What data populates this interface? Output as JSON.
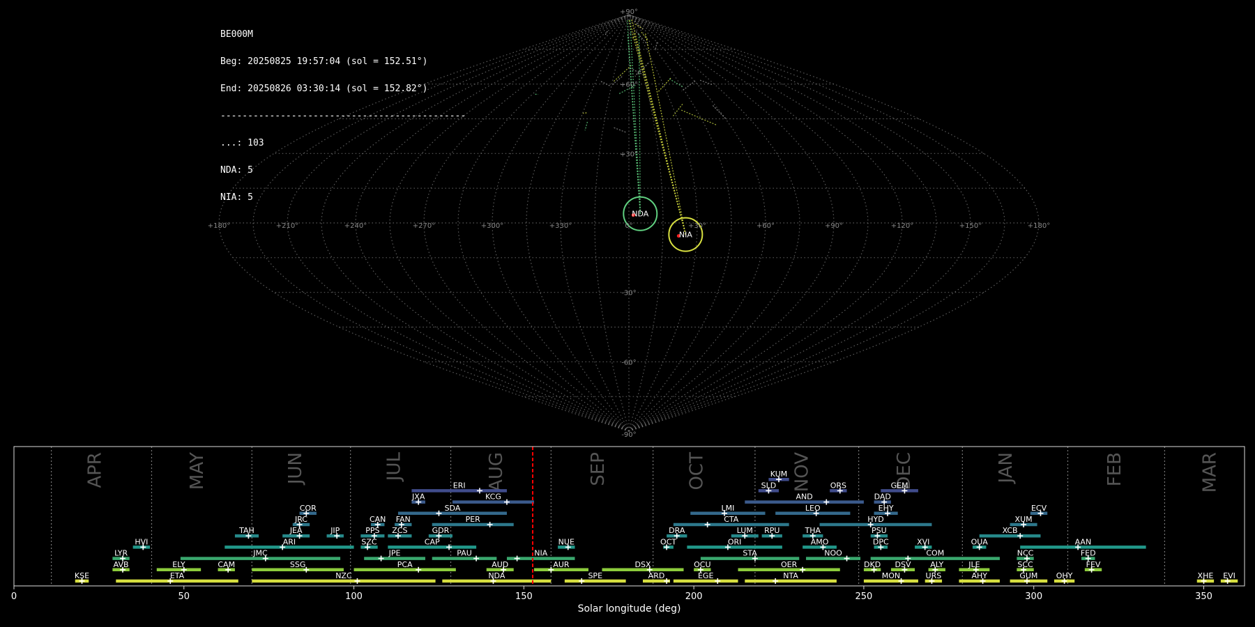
{
  "info": {
    "station": "BE000M",
    "beg": "Beg: 20250825 19:57:04 (sol = 152.51°)",
    "end": "End: 20250826 03:30:14 (sol = 152.82°)",
    "rule": "---------------------------------------------",
    "counts": [
      "...: 103",
      "NDA: 5",
      "NIA: 5"
    ]
  },
  "colors": {
    "background": "#000000",
    "grid": "#7a7a7a",
    "marker": "#ff2020",
    "current_line": "#ff0000",
    "month_text": "#555555",
    "label_text": "#ffffff",
    "circle_nda": "#60d080",
    "circle_nia": "#d8e040"
  },
  "chart_data": [
    {
      "type": "scatter",
      "projection": "sinusoidal",
      "lon_tick_labels": [
        "+180°",
        "+150°",
        "+120°",
        "+90°",
        "+60°",
        "+30°",
        "0°",
        "+330°",
        "+300°",
        "+270°",
        "+240°",
        "+210°",
        "+180°"
      ],
      "lat_tick_labels": [
        "+90°",
        "+60°",
        "+30°",
        "-30°",
        "-60°",
        "-90°"
      ],
      "radiants": [
        {
          "name": "NDA",
          "lon": -5,
          "lat": 4,
          "color": "#60d080"
        },
        {
          "name": "NIA",
          "lon": -25,
          "lat": -5,
          "color": "#d8e040"
        }
      ]
    },
    {
      "type": "bar",
      "orientation": "horizontal",
      "xlabel": "Solar longitude (deg)",
      "xlim": [
        0,
        362
      ],
      "x_ticks": [
        0,
        50,
        100,
        150,
        200,
        250,
        300,
        350
      ],
      "current_sol": 152.6,
      "months": [
        {
          "name": "APR",
          "start": 11,
          "label_x": 24
        },
        {
          "name": "MAY",
          "start": 40.5,
          "label_x": 54
        },
        {
          "name": "JUN",
          "start": 70,
          "label_x": 83
        },
        {
          "name": "JUL",
          "start": 99,
          "label_x": 112
        },
        {
          "name": "AUG",
          "start": 128.5,
          "label_x": 142
        },
        {
          "name": "SEP",
          "start": 158,
          "label_x": 172
        },
        {
          "name": "OCT",
          "start": 188,
          "label_x": 201
        },
        {
          "name": "NOV",
          "start": 218,
          "label_x": 232
        },
        {
          "name": "DEC",
          "start": 248.5,
          "label_x": 262
        },
        {
          "name": "JAN",
          "start": 279,
          "label_x": 292
        },
        {
          "name": "FEB",
          "start": 310,
          "label_x": 324
        },
        {
          "name": "MAR",
          "start": 338.5,
          "label_x": 352
        }
      ],
      "showers": [
        {
          "code": "KUM",
          "start": 222,
          "end": 228,
          "peak": 225,
          "row": 10,
          "color": "#404c8c"
        },
        {
          "code": "ERI",
          "start": 117,
          "end": 145,
          "peak": 137,
          "row": 9,
          "color": "#404c8c"
        },
        {
          "code": "SLD",
          "start": 219,
          "end": 225,
          "peak": 222,
          "row": 9,
          "color": "#404c8c"
        },
        {
          "code": "ORS",
          "start": 240,
          "end": 245,
          "peak": 243,
          "row": 9,
          "color": "#404c8c"
        },
        {
          "code": "GEM",
          "start": 255,
          "end": 266,
          "peak": 262,
          "row": 9,
          "color": "#404c8c"
        },
        {
          "code": "JXA",
          "start": 117,
          "end": 121,
          "peak": 119,
          "row": 8,
          "color": "#3b5a8c"
        },
        {
          "code": "KCG",
          "start": 129,
          "end": 153,
          "peak": 145,
          "row": 8,
          "color": "#3b5a8c"
        },
        {
          "code": "AND",
          "start": 215,
          "end": 250,
          "peak": 239,
          "row": 8,
          "color": "#3b5a8c"
        },
        {
          "code": "DAD",
          "start": 253,
          "end": 258,
          "peak": 256,
          "row": 8,
          "color": "#3b5a8c"
        },
        {
          "code": "COR",
          "start": 84,
          "end": 89,
          "peak": 86,
          "row": 7,
          "color": "#34698c"
        },
        {
          "code": "SDA",
          "start": 113,
          "end": 145,
          "peak": 125,
          "row": 7,
          "color": "#34698c"
        },
        {
          "code": "LMI",
          "start": 199,
          "end": 221,
          "peak": 209,
          "row": 7,
          "color": "#34698c"
        },
        {
          "code": "LEO",
          "start": 224,
          "end": 246,
          "peak": 236,
          "row": 7,
          "color": "#34698c"
        },
        {
          "code": "EHY",
          "start": 253,
          "end": 260,
          "peak": 257,
          "row": 7,
          "color": "#34698c"
        },
        {
          "code": "ECV",
          "start": 299,
          "end": 304,
          "peak": 302,
          "row": 7,
          "color": "#34698c"
        },
        {
          "code": "JRC",
          "start": 82,
          "end": 87,
          "peak": 84,
          "row": 6,
          "color": "#2d788c"
        },
        {
          "code": "CAN",
          "start": 105,
          "end": 109,
          "peak": 107,
          "row": 6,
          "color": "#2d788c"
        },
        {
          "code": "FAN",
          "start": 112,
          "end": 117,
          "peak": 114,
          "row": 6,
          "color": "#2d788c"
        },
        {
          "code": "PER",
          "start": 123,
          "end": 147,
          "peak": 140,
          "row": 6,
          "color": "#2d788c"
        },
        {
          "code": "CTA",
          "start": 194,
          "end": 228,
          "peak": 204,
          "row": 6,
          "color": "#2d788c"
        },
        {
          "code": "HYD",
          "start": 237,
          "end": 270,
          "peak": 252,
          "row": 6,
          "color": "#2d788c"
        },
        {
          "code": "XUM",
          "start": 293,
          "end": 301,
          "peak": 297,
          "row": 6,
          "color": "#2d788c"
        },
        {
          "code": "TAH",
          "start": 65,
          "end": 72,
          "peak": 69,
          "row": 5,
          "color": "#26898a"
        },
        {
          "code": "JEA",
          "start": 79,
          "end": 87,
          "peak": 84,
          "row": 5,
          "color": "#26898a"
        },
        {
          "code": "JIP",
          "start": 92,
          "end": 97,
          "peak": 95,
          "row": 5,
          "color": "#26898a"
        },
        {
          "code": "PPS",
          "start": 102,
          "end": 109,
          "peak": 106,
          "row": 5,
          "color": "#26898a"
        },
        {
          "code": "ZCS",
          "start": 110,
          "end": 117,
          "peak": 113,
          "row": 5,
          "color": "#26898a"
        },
        {
          "code": "GDR",
          "start": 122,
          "end": 129,
          "peak": 125,
          "row": 5,
          "color": "#26898a"
        },
        {
          "code": "DRA",
          "start": 192,
          "end": 198,
          "peak": 195,
          "row": 5,
          "color": "#26898a"
        },
        {
          "code": "LUM",
          "start": 211,
          "end": 219,
          "peak": 215,
          "row": 5,
          "color": "#26898a"
        },
        {
          "code": "RPU",
          "start": 220,
          "end": 226,
          "peak": 223,
          "row": 5,
          "color": "#26898a"
        },
        {
          "code": "THA",
          "start": 232,
          "end": 238,
          "peak": 235,
          "row": 5,
          "color": "#26898a"
        },
        {
          "code": "PSU",
          "start": 252,
          "end": 257,
          "peak": 254,
          "row": 5,
          "color": "#26898a"
        },
        {
          "code": "XCB",
          "start": 284,
          "end": 302,
          "peak": 296,
          "row": 5,
          "color": "#26898a"
        },
        {
          "code": "HVI",
          "start": 35,
          "end": 40,
          "peak": 38,
          "row": 4,
          "color": "#21988a"
        },
        {
          "code": "ARI",
          "start": 62,
          "end": 100,
          "peak": 79,
          "row": 4,
          "color": "#21988a"
        },
        {
          "code": "SZC",
          "start": 102,
          "end": 107,
          "peak": 104,
          "row": 4,
          "color": "#21988a"
        },
        {
          "code": "CAP",
          "start": 110,
          "end": 136,
          "peak": 128,
          "row": 4,
          "color": "#21988a"
        },
        {
          "code": "NUE",
          "start": 160,
          "end": 165,
          "peak": 163,
          "row": 4,
          "color": "#21988a"
        },
        {
          "code": "OCT",
          "start": 191,
          "end": 194,
          "peak": 192,
          "row": 4,
          "color": "#21988a"
        },
        {
          "code": "ORI",
          "start": 198,
          "end": 226,
          "peak": 210,
          "row": 4,
          "color": "#21988a"
        },
        {
          "code": "AMO",
          "start": 232,
          "end": 242,
          "peak": 238,
          "row": 4,
          "color": "#21988a"
        },
        {
          "code": "DPC",
          "start": 253,
          "end": 257,
          "peak": 255,
          "row": 4,
          "color": "#21988a"
        },
        {
          "code": "XVI",
          "start": 265,
          "end": 270,
          "peak": 268,
          "row": 4,
          "color": "#21988a"
        },
        {
          "code": "OUA",
          "start": 282,
          "end": 286,
          "peak": 284,
          "row": 4,
          "color": "#21988a"
        },
        {
          "code": "AAN",
          "start": 296,
          "end": 333,
          "peak": 313,
          "row": 4,
          "color": "#21988a"
        },
        {
          "code": "LYR",
          "start": 29,
          "end": 34,
          "peak": 32,
          "row": 3,
          "color": "#3aa86e"
        },
        {
          "code": "JMC",
          "start": 49,
          "end": 96,
          "peak": 74,
          "row": 3,
          "color": "#3aa86e"
        },
        {
          "code": "JPE",
          "start": 103,
          "end": 121,
          "peak": 108,
          "row": 3,
          "color": "#3aa86e"
        },
        {
          "code": "PAU",
          "start": 123,
          "end": 142,
          "peak": 136,
          "row": 3,
          "color": "#3aa86e"
        },
        {
          "code": "NIA",
          "start": 145,
          "end": 165,
          "peak": 148,
          "row": 3,
          "color": "#3aa86e"
        },
        {
          "code": "STA",
          "start": 202,
          "end": 231,
          "peak": 218,
          "row": 3,
          "color": "#3aa86e"
        },
        {
          "code": "NOO",
          "start": 233,
          "end": 249,
          "peak": 245,
          "row": 3,
          "color": "#3aa86e"
        },
        {
          "code": "COM",
          "start": 252,
          "end": 290,
          "peak": 263,
          "row": 3,
          "color": "#3aa86e"
        },
        {
          "code": "NCC",
          "start": 295,
          "end": 300,
          "peak": 298,
          "row": 3,
          "color": "#3aa86e"
        },
        {
          "code": "FED",
          "start": 314,
          "end": 318,
          "peak": 316,
          "row": 3,
          "color": "#3aa86e"
        },
        {
          "code": "AVB",
          "start": 29,
          "end": 34,
          "peak": 32,
          "row": 2,
          "color": "#8ccc3c"
        },
        {
          "code": "ELY",
          "start": 42,
          "end": 55,
          "peak": 50,
          "row": 2,
          "color": "#8ccc3c"
        },
        {
          "code": "CAM",
          "start": 60,
          "end": 65,
          "peak": 63,
          "row": 2,
          "color": "#8ccc3c"
        },
        {
          "code": "SSG",
          "start": 70,
          "end": 97,
          "peak": 86,
          "row": 2,
          "color": "#8ccc3c"
        },
        {
          "code": "PCA",
          "start": 100,
          "end": 130,
          "peak": 119,
          "row": 2,
          "color": "#8ccc3c"
        },
        {
          "code": "AUD",
          "start": 139,
          "end": 147,
          "peak": 144,
          "row": 2,
          "color": "#8ccc3c"
        },
        {
          "code": "AUR",
          "start": 153,
          "end": 169,
          "peak": 158,
          "row": 2,
          "color": "#8ccc3c"
        },
        {
          "code": "DSX",
          "start": 173,
          "end": 197,
          "peak": 187,
          "row": 2,
          "color": "#8ccc3c"
        },
        {
          "code": "OCU",
          "start": 200,
          "end": 205,
          "peak": 202,
          "row": 2,
          "color": "#8ccc3c"
        },
        {
          "code": "OER",
          "start": 213,
          "end": 243,
          "peak": 232,
          "row": 2,
          "color": "#8ccc3c"
        },
        {
          "code": "DKD",
          "start": 250,
          "end": 255,
          "peak": 253,
          "row": 2,
          "color": "#8ccc3c"
        },
        {
          "code": "DSV",
          "start": 258,
          "end": 265,
          "peak": 262,
          "row": 2,
          "color": "#8ccc3c"
        },
        {
          "code": "ALY",
          "start": 269,
          "end": 274,
          "peak": 271,
          "row": 2,
          "color": "#8ccc3c"
        },
        {
          "code": "JLE",
          "start": 278,
          "end": 287,
          "peak": 283,
          "row": 2,
          "color": "#8ccc3c"
        },
        {
          "code": "SCC",
          "start": 295,
          "end": 300,
          "peak": 297,
          "row": 2,
          "color": "#8ccc3c"
        },
        {
          "code": "FEV",
          "start": 315,
          "end": 320,
          "peak": 317,
          "row": 2,
          "color": "#8ccc3c"
        },
        {
          "code": "KSE",
          "start": 18,
          "end": 22,
          "peak": 20,
          "row": 1,
          "color": "#d8e040"
        },
        {
          "code": "ETA",
          "start": 30,
          "end": 66,
          "peak": 46,
          "row": 1,
          "color": "#d8e040"
        },
        {
          "code": "NZC",
          "start": 70,
          "end": 124,
          "peak": 101,
          "row": 1,
          "color": "#d8e040"
        },
        {
          "code": "NDA",
          "start": 126,
          "end": 158,
          "peak": 141,
          "row": 1,
          "color": "#d8e040"
        },
        {
          "code": "SPE",
          "start": 162,
          "end": 180,
          "peak": 167,
          "row": 1,
          "color": "#d8e040"
        },
        {
          "code": "ARD",
          "start": 185,
          "end": 193,
          "peak": 192,
          "row": 1,
          "color": "#d8e040"
        },
        {
          "code": "EGE",
          "start": 194,
          "end": 213,
          "peak": 207,
          "row": 1,
          "color": "#d8e040"
        },
        {
          "code": "NTA",
          "start": 215,
          "end": 242,
          "peak": 224,
          "row": 1,
          "color": "#d8e040"
        },
        {
          "code": "MON",
          "start": 250,
          "end": 266,
          "peak": 261,
          "row": 1,
          "color": "#d8e040"
        },
        {
          "code": "URS",
          "start": 268,
          "end": 273,
          "peak": 270,
          "row": 1,
          "color": "#d8e040"
        },
        {
          "code": "AHY",
          "start": 278,
          "end": 290,
          "peak": 285,
          "row": 1,
          "color": "#d8e040"
        },
        {
          "code": "GUM",
          "start": 293,
          "end": 304,
          "peak": 298,
          "row": 1,
          "color": "#d8e040"
        },
        {
          "code": "OHY",
          "start": 306,
          "end": 312,
          "peak": 309,
          "row": 1,
          "color": "#d8e040"
        },
        {
          "code": "XHE",
          "start": 348,
          "end": 353,
          "peak": 350,
          "row": 1,
          "color": "#d8e040"
        },
        {
          "code": "EVI",
          "start": 355,
          "end": 360,
          "peak": 357,
          "row": 1,
          "color": "#d8e040"
        }
      ]
    }
  ]
}
